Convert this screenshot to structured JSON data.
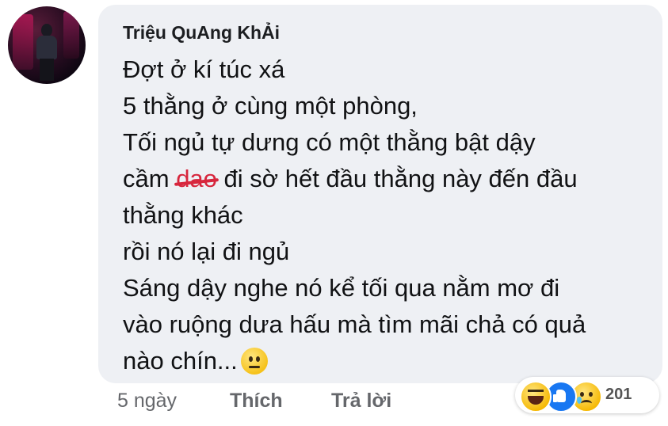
{
  "comment": {
    "author": "Triệu QuAng KhẢi",
    "lines": [
      "Đợt ở kí túc xá",
      "5 thằng ở cùng một phòng,",
      "Tối ngủ tự dưng có một thằng bật dậy",
      {
        "before": "cầm ",
        "struck": "dao",
        "after": " đi sờ hết đầu thằng này đến đầu"
      },
      "thằng khác",
      "rồi nó lại đi ngủ",
      "Sáng dậy nghe nó kể tối qua nằm mơ đi",
      "vào ruộng dưa hấu mà tìm mãi chả có quả",
      "nào chín..."
    ],
    "inline_emoji": "neutral-face-icon"
  },
  "actions": {
    "time": "5 ngày",
    "like": "Thích",
    "reply": "Trả lời"
  },
  "reactions": {
    "icons": [
      "haha-icon",
      "like-icon",
      "sad-icon"
    ],
    "count": "201"
  },
  "colors": {
    "bubble": "#eef0f4",
    "strike": "#d7263d",
    "like_blue": "#1877f2"
  }
}
